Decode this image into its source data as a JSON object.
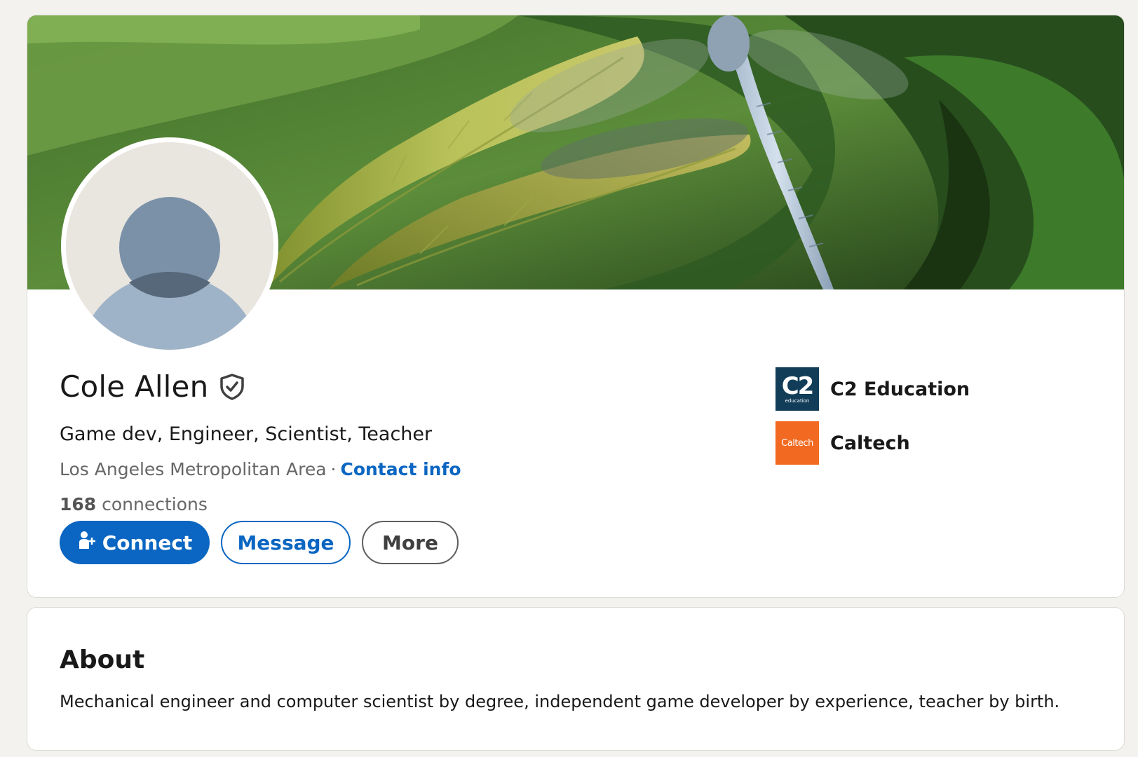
{
  "profile": {
    "name": "Cole Allen",
    "headline": "Game dev, Engineer, Scientist, Teacher",
    "location": "Los Angeles Metropolitan Area",
    "separator": "·",
    "contact_info_label": "Contact info",
    "connections_count": "168",
    "connections_label": "connections"
  },
  "actions": {
    "connect_label": "Connect",
    "message_label": "Message",
    "more_label": "More"
  },
  "affiliations": [
    {
      "name": "C2 Education",
      "logo_text": "C2",
      "logo_subtext": "education",
      "logo_color": "#123d58"
    },
    {
      "name": "Caltech",
      "logo_text": "Caltech",
      "logo_color": "#f26a21"
    }
  ],
  "about": {
    "title": "About",
    "text": "Mechanical engineer and computer scientist by degree, independent game developer by experience, teacher by birth."
  },
  "colors": {
    "accent": "#0a66c2",
    "page_background": "#f3f2ef",
    "card_background": "#ffffff"
  },
  "icons": {
    "verified": "shield-check-icon",
    "connect": "add-person-icon"
  }
}
